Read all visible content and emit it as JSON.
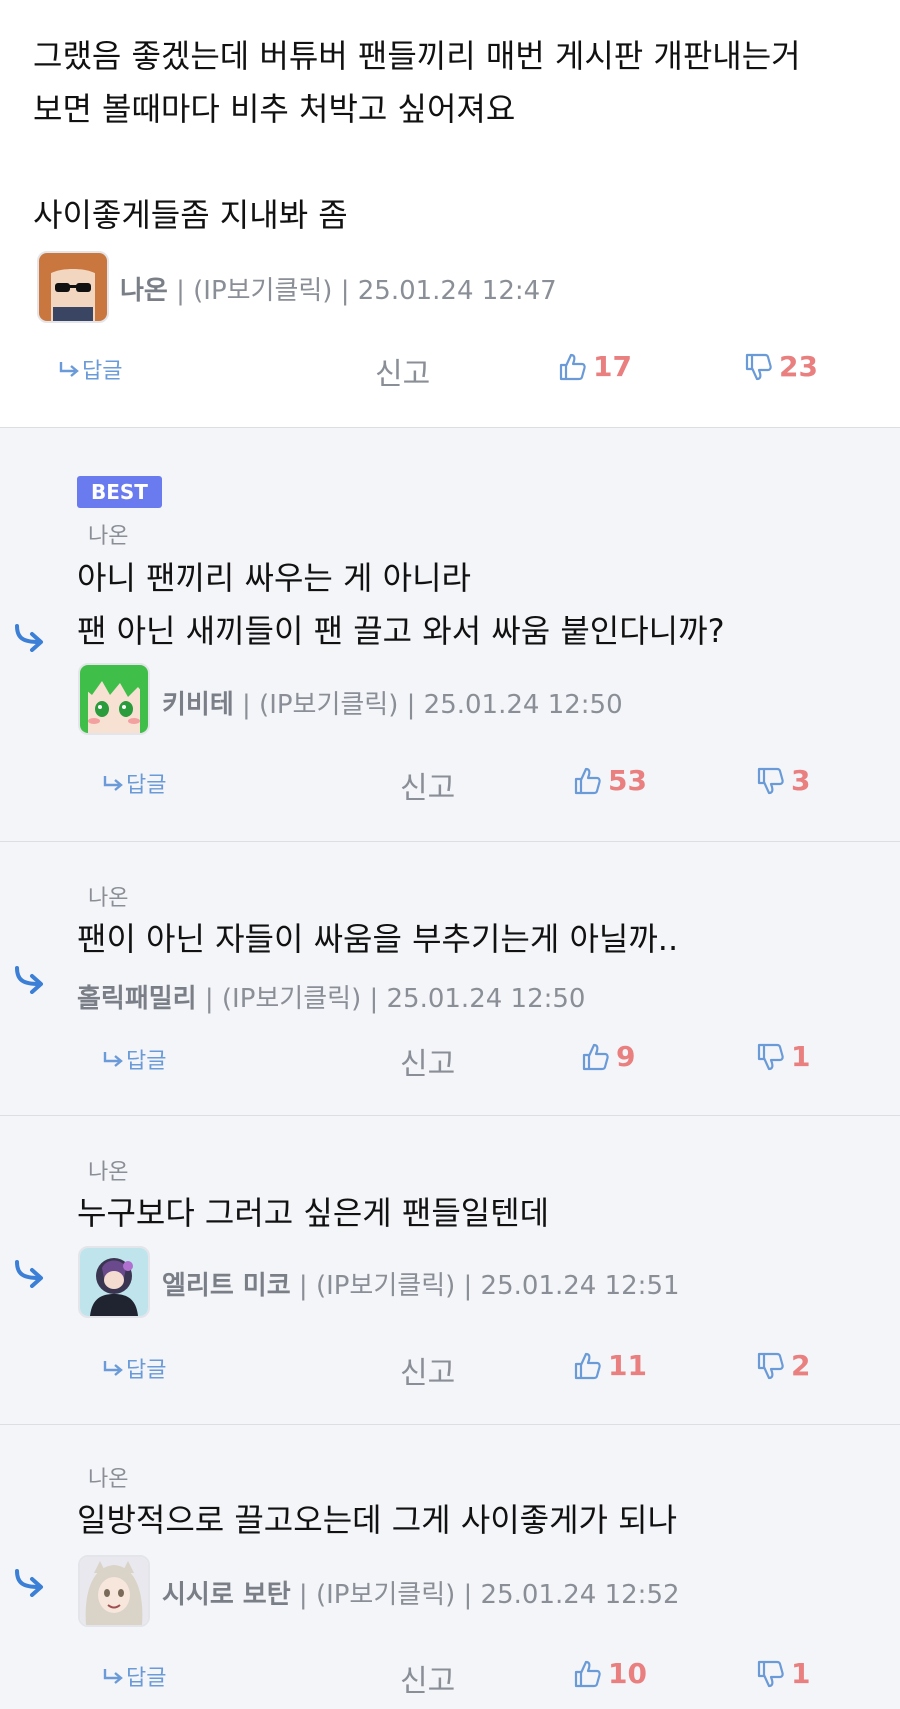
{
  "main_comment": {
    "text": "그랬음 좋겠는데 버튜버 팬들끼리 매번 게시판 개판내는거\n보면 볼때마다 비추 처박고 싶어져요\n\n사이좋게들좀 지내봐 좀",
    "author": "나온",
    "ip": "| (IP보기클릭) | 25.01.24 12:47",
    "reply_label": "답글",
    "report_label": "신고",
    "likes": "17",
    "dislikes": "23"
  },
  "replies": [
    {
      "badge": "BEST",
      "reply_to": "나온",
      "text": "아니 팬끼리 싸우는 게 아니라\n팬 아닌 새끼들이 팬 끌고 와서 싸움 붙인다니까?",
      "author": "키비테",
      "ip": "| (IP보기클릭) | 25.01.24 12:50",
      "reply_label": "답글",
      "report_label": "신고",
      "likes": "53",
      "dislikes": "3"
    },
    {
      "reply_to": "나온",
      "text": "팬이 아닌 자들이 싸움을 부추기는게 아닐까..",
      "author": "홀릭패밀리",
      "ip": "| (IP보기클릭) | 25.01.24 12:50",
      "reply_label": "답글",
      "report_label": "신고",
      "likes": "9",
      "dislikes": "1"
    },
    {
      "reply_to": "나온",
      "text": "누구보다 그러고 싶은게 팬들일텐데",
      "author": "엘리트 미코",
      "ip": "| (IP보기클릭) | 25.01.24 12:51",
      "reply_label": "답글",
      "report_label": "신고",
      "likes": "11",
      "dislikes": "2"
    },
    {
      "reply_to": "나온",
      "text": "일방적으로 끌고오는데 그게 사이좋게가 되나",
      "author": "시시로 보탄",
      "ip": "| (IP보기클릭) | 25.01.24 12:52",
      "reply_label": "답글",
      "report_label": "신고",
      "likes": "10",
      "dislikes": "1"
    }
  ],
  "colors": {
    "accent_blue": "#3b7fd6",
    "like_red": "#e97f7f",
    "thumb_blue": "#6a9bd8",
    "best_badge": "#6a7bf0"
  }
}
